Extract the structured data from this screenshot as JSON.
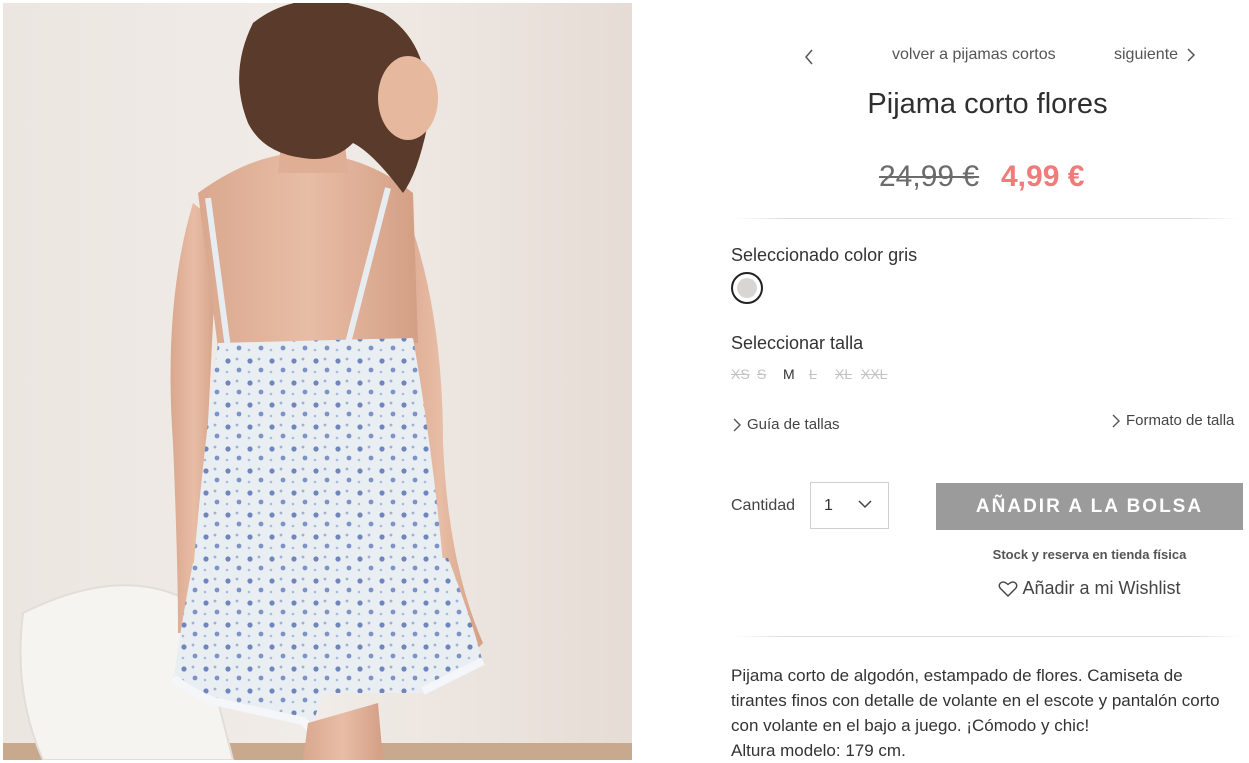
{
  "nav": {
    "back_label": "volver a pijamas cortos",
    "next_label": "siguiente"
  },
  "product": {
    "title": "Pijama corto flores",
    "price_old": "24,99 €",
    "price_new": "4,99 €",
    "color_label": "Seleccionado color gris",
    "color_swatch": "#d8d5d5",
    "size_label": "Seleccionar talla",
    "sizes": [
      {
        "label": "XS",
        "available": false
      },
      {
        "label": "S",
        "available": false
      },
      {
        "label": "M",
        "available": true
      },
      {
        "label": "L",
        "available": false
      },
      {
        "label": "XL",
        "available": false
      },
      {
        "label": "XXL",
        "available": false
      }
    ],
    "size_guide": "Guía de tallas",
    "size_format": "Formato de talla",
    "quantity_label": "Cantidad",
    "quantity_value": "1",
    "add_to_bag": "AÑADIR A LA BOLSA",
    "stock_label": "Stock y reserva en tienda física",
    "wishlist_label": "Añadir a mi Wishlist",
    "description": [
      "Pijama corto de algodón, estampado de flores. Camiseta de tirantes finos con detalle de volante en el escote y pantalón corto con volante en el bajo a juego. ¡Cómodo y chic!",
      "Altura modelo: 179 cm."
    ]
  },
  "colors": {
    "sale_price": "#f07b7b",
    "button_bg": "#9b9b9b"
  }
}
